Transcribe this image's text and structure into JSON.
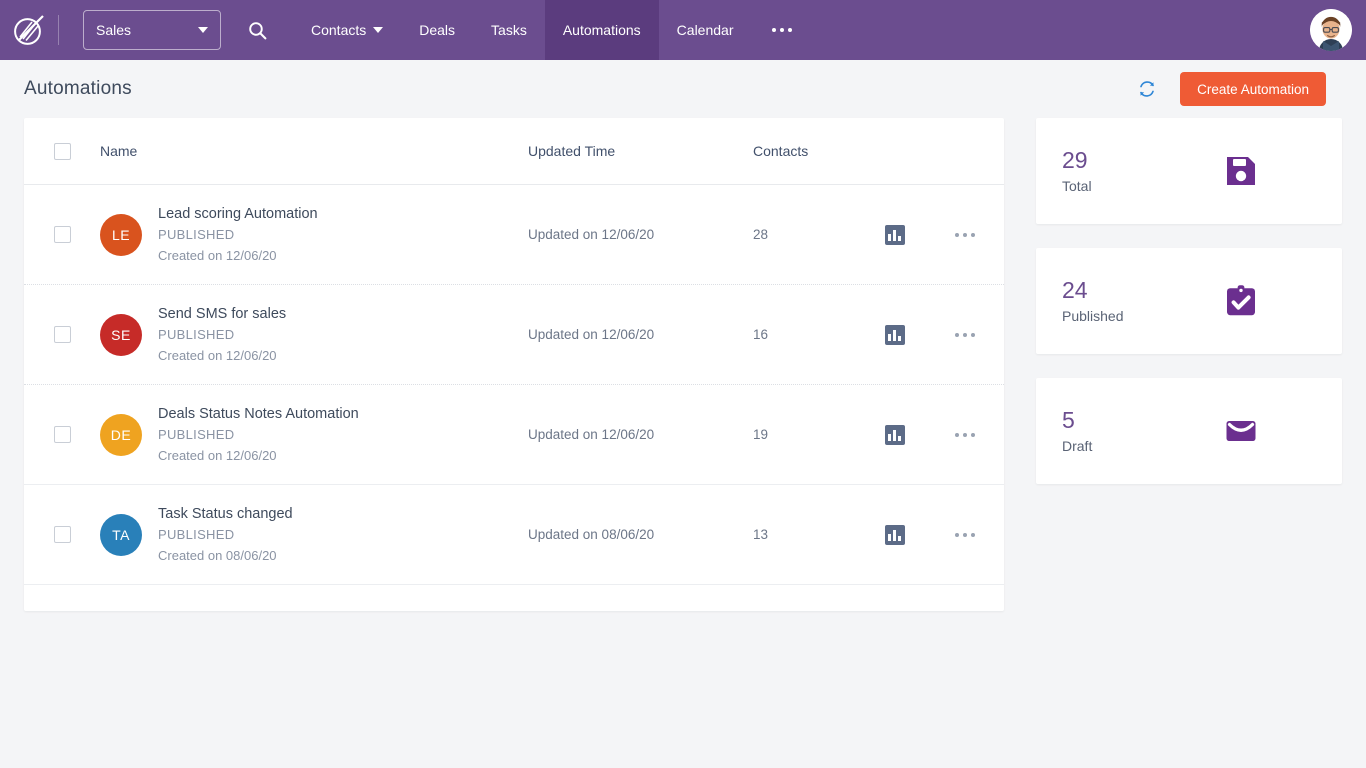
{
  "navbar": {
    "logo_icon": "dart-circle-logo",
    "workspace": {
      "value": "Sales",
      "icon": "chevron-down-icon"
    },
    "search_icon": "search-icon",
    "items": [
      {
        "label": "Contacts",
        "has_caret": true,
        "active": false
      },
      {
        "label": "Deals",
        "has_caret": false,
        "active": false
      },
      {
        "label": "Tasks",
        "has_caret": false,
        "active": false
      },
      {
        "label": "Automations",
        "has_caret": false,
        "active": true
      },
      {
        "label": "Calendar",
        "has_caret": false,
        "active": false
      }
    ],
    "more_icon": "more-horizontal-icon",
    "avatar_icon": "user-avatar",
    "bg_color": "#6b4d8f",
    "active_bg_color": "#5b3c7e"
  },
  "header": {
    "title": "Automations",
    "refresh_icon": "refresh-icon",
    "create_button": "Create Automation",
    "create_button_color": "#ef5b35"
  },
  "table": {
    "select_all_checkbox": false,
    "columns": [
      "Name",
      "Updated Time",
      "Contacts"
    ],
    "rows": [
      {
        "checked": false,
        "initials": "LE",
        "avatar_color": "#d9531e",
        "name": "Lead scoring Automation",
        "status": "PUBLISHED",
        "created": "Created on 12/06/20",
        "updated": "Updated on 12/06/20",
        "contacts": "28",
        "stats_icon": "bar-chart-icon",
        "menu_icon": "more-horizontal-icon"
      },
      {
        "checked": false,
        "initials": "SE",
        "avatar_color": "#c62b28",
        "name": "Send SMS for sales",
        "status": "PUBLISHED",
        "created": "Created on 12/06/20",
        "updated": "Updated on 12/06/20",
        "contacts": "16",
        "stats_icon": "bar-chart-icon",
        "menu_icon": "more-horizontal-icon"
      },
      {
        "checked": false,
        "initials": "DE",
        "avatar_color": "#efa320",
        "name": "Deals Status Notes Automation",
        "status": "PUBLISHED",
        "created": "Created on 12/06/20",
        "updated": "Updated on 12/06/20",
        "contacts": "19",
        "stats_icon": "bar-chart-icon",
        "menu_icon": "more-horizontal-icon"
      },
      {
        "checked": false,
        "initials": "TA",
        "avatar_color": "#2980b9",
        "name": "Task Status changed",
        "status": "PUBLISHED",
        "created": "Created on 08/06/20",
        "updated": "Updated on 08/06/20",
        "contacts": "13",
        "stats_icon": "bar-chart-icon",
        "menu_icon": "more-horizontal-icon"
      }
    ]
  },
  "stats": {
    "accent_color": "#6b4d8f",
    "cards": [
      {
        "value": "29",
        "label": "Total",
        "icon": "floppy-save-icon"
      },
      {
        "value": "24",
        "label": "Published",
        "icon": "clipboard-check-icon"
      },
      {
        "value": "5",
        "label": "Draft",
        "icon": "envelope-icon"
      }
    ]
  }
}
